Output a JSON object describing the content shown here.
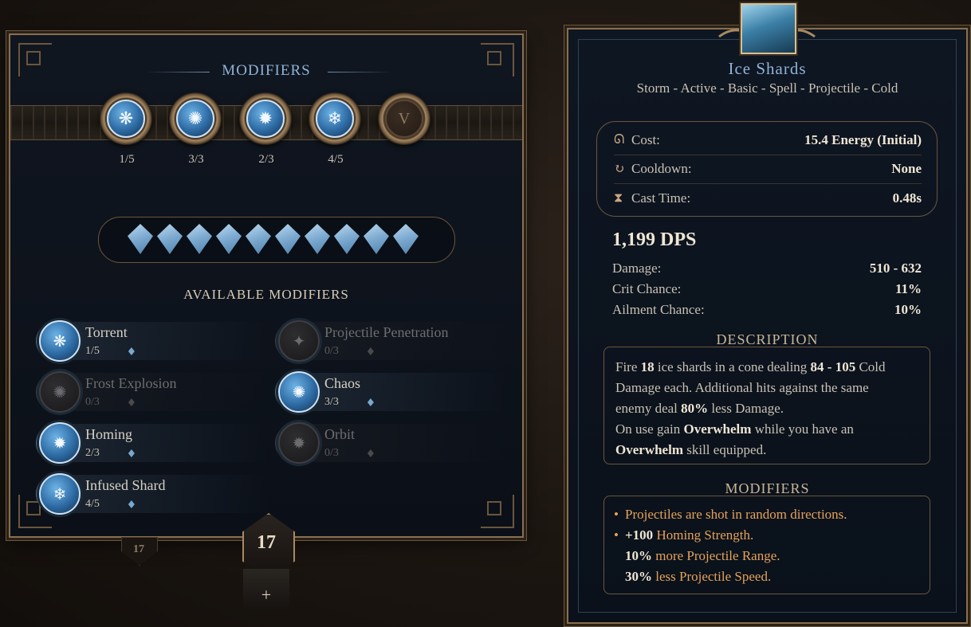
{
  "left": {
    "title": "MODIFIERS",
    "available_title": "AVAILABLE MODIFIERS",
    "slots": [
      {
        "count": "1/5",
        "glyph": "❋",
        "icon": "torrent-icon"
      },
      {
        "count": "3/3",
        "glyph": "✺",
        "icon": "chaos-icon"
      },
      {
        "count": "2/3",
        "glyph": "✹",
        "icon": "homing-icon"
      },
      {
        "count": "4/5",
        "glyph": "❄",
        "icon": "infused-shard-icon"
      },
      {
        "count": "",
        "glyph": "V",
        "icon": "locked-slot-icon"
      }
    ],
    "diamond_count": 10,
    "modifiers": [
      {
        "name": "Torrent",
        "count": "1/5",
        "active": true,
        "glyph": "❋",
        "col": 0,
        "row": 0
      },
      {
        "name": "Projectile Penetration",
        "count": "0/3",
        "active": false,
        "glyph": "✦",
        "col": 1,
        "row": 0
      },
      {
        "name": "Frost Explosion",
        "count": "0/3",
        "active": false,
        "glyph": "✺",
        "col": 0,
        "row": 1
      },
      {
        "name": "Chaos",
        "count": "3/3",
        "active": true,
        "glyph": "✺",
        "col": 1,
        "row": 1
      },
      {
        "name": "Homing",
        "count": "2/3",
        "active": true,
        "glyph": "✹",
        "col": 0,
        "row": 2
      },
      {
        "name": "Orbit",
        "count": "0/3",
        "active": false,
        "glyph": "✹",
        "col": 1,
        "row": 2
      },
      {
        "name": "Infused Shard",
        "count": "4/5",
        "active": true,
        "glyph": "❄",
        "col": 0,
        "row": 3
      }
    ],
    "level": "17",
    "small_level": "17",
    "plus": "+"
  },
  "right": {
    "title": "Ice Shards",
    "tags": "Storm - Active - Basic - Spell - Projectile - Cold",
    "stats": [
      {
        "icon": "energy-icon",
        "glyph": "ᘏ",
        "label": "Cost:",
        "value": "15.4 Energy (Initial)"
      },
      {
        "icon": "cooldown-icon",
        "glyph": "↻",
        "label": "Cooldown:",
        "value": "None"
      },
      {
        "icon": "hourglass-icon",
        "glyph": "⧗",
        "label": "Cast Time:",
        "value": "0.48s"
      }
    ],
    "dps": "1,199 DPS",
    "damage_rows": [
      {
        "label": "Damage:",
        "value": "510 - 632"
      },
      {
        "label": "Crit Chance:",
        "value": "11%"
      },
      {
        "label": "Ailment Chance:",
        "value": "10%"
      }
    ],
    "description_title": "DESCRIPTION",
    "description": [
      [
        {
          "t": "Fire "
        },
        {
          "b": "18"
        },
        {
          "t": " ice shards in a cone dealing "
        },
        {
          "b": "84 - 105"
        },
        {
          "t": " Cold"
        }
      ],
      [
        {
          "t": "Damage each. Additional hits against the same"
        }
      ],
      [
        {
          "t": "enemy deal "
        },
        {
          "b": "80%"
        },
        {
          "t": " less Damage."
        }
      ],
      [
        {
          "t": "On use gain "
        },
        {
          "b": "Overwhelm"
        },
        {
          "t": " while you have an"
        }
      ],
      [
        {
          "b": "Overwhelm"
        },
        {
          "t": " skill equipped."
        }
      ]
    ],
    "modifiers_title": "MODIFIERS",
    "modifier_lines": [
      {
        "bullet": true,
        "parts": [
          {
            "t": "Projectiles are shot in random directions."
          }
        ]
      },
      {
        "bullet": true,
        "parts": [
          {
            "b": "+100"
          },
          {
            "t": " Homing Strength."
          }
        ]
      },
      {
        "bullet": false,
        "parts": [
          {
            "b": "10%"
          },
          {
            "t": " more Projectile Range."
          }
        ]
      },
      {
        "bullet": false,
        "parts": [
          {
            "b": "30%"
          },
          {
            "t": " less Projectile Speed."
          }
        ]
      }
    ]
  },
  "colors": {
    "accent_blue": "#8fb3d6",
    "modifier_orange": "#e7a25a",
    "frame_gold": "#8a6f4e"
  }
}
